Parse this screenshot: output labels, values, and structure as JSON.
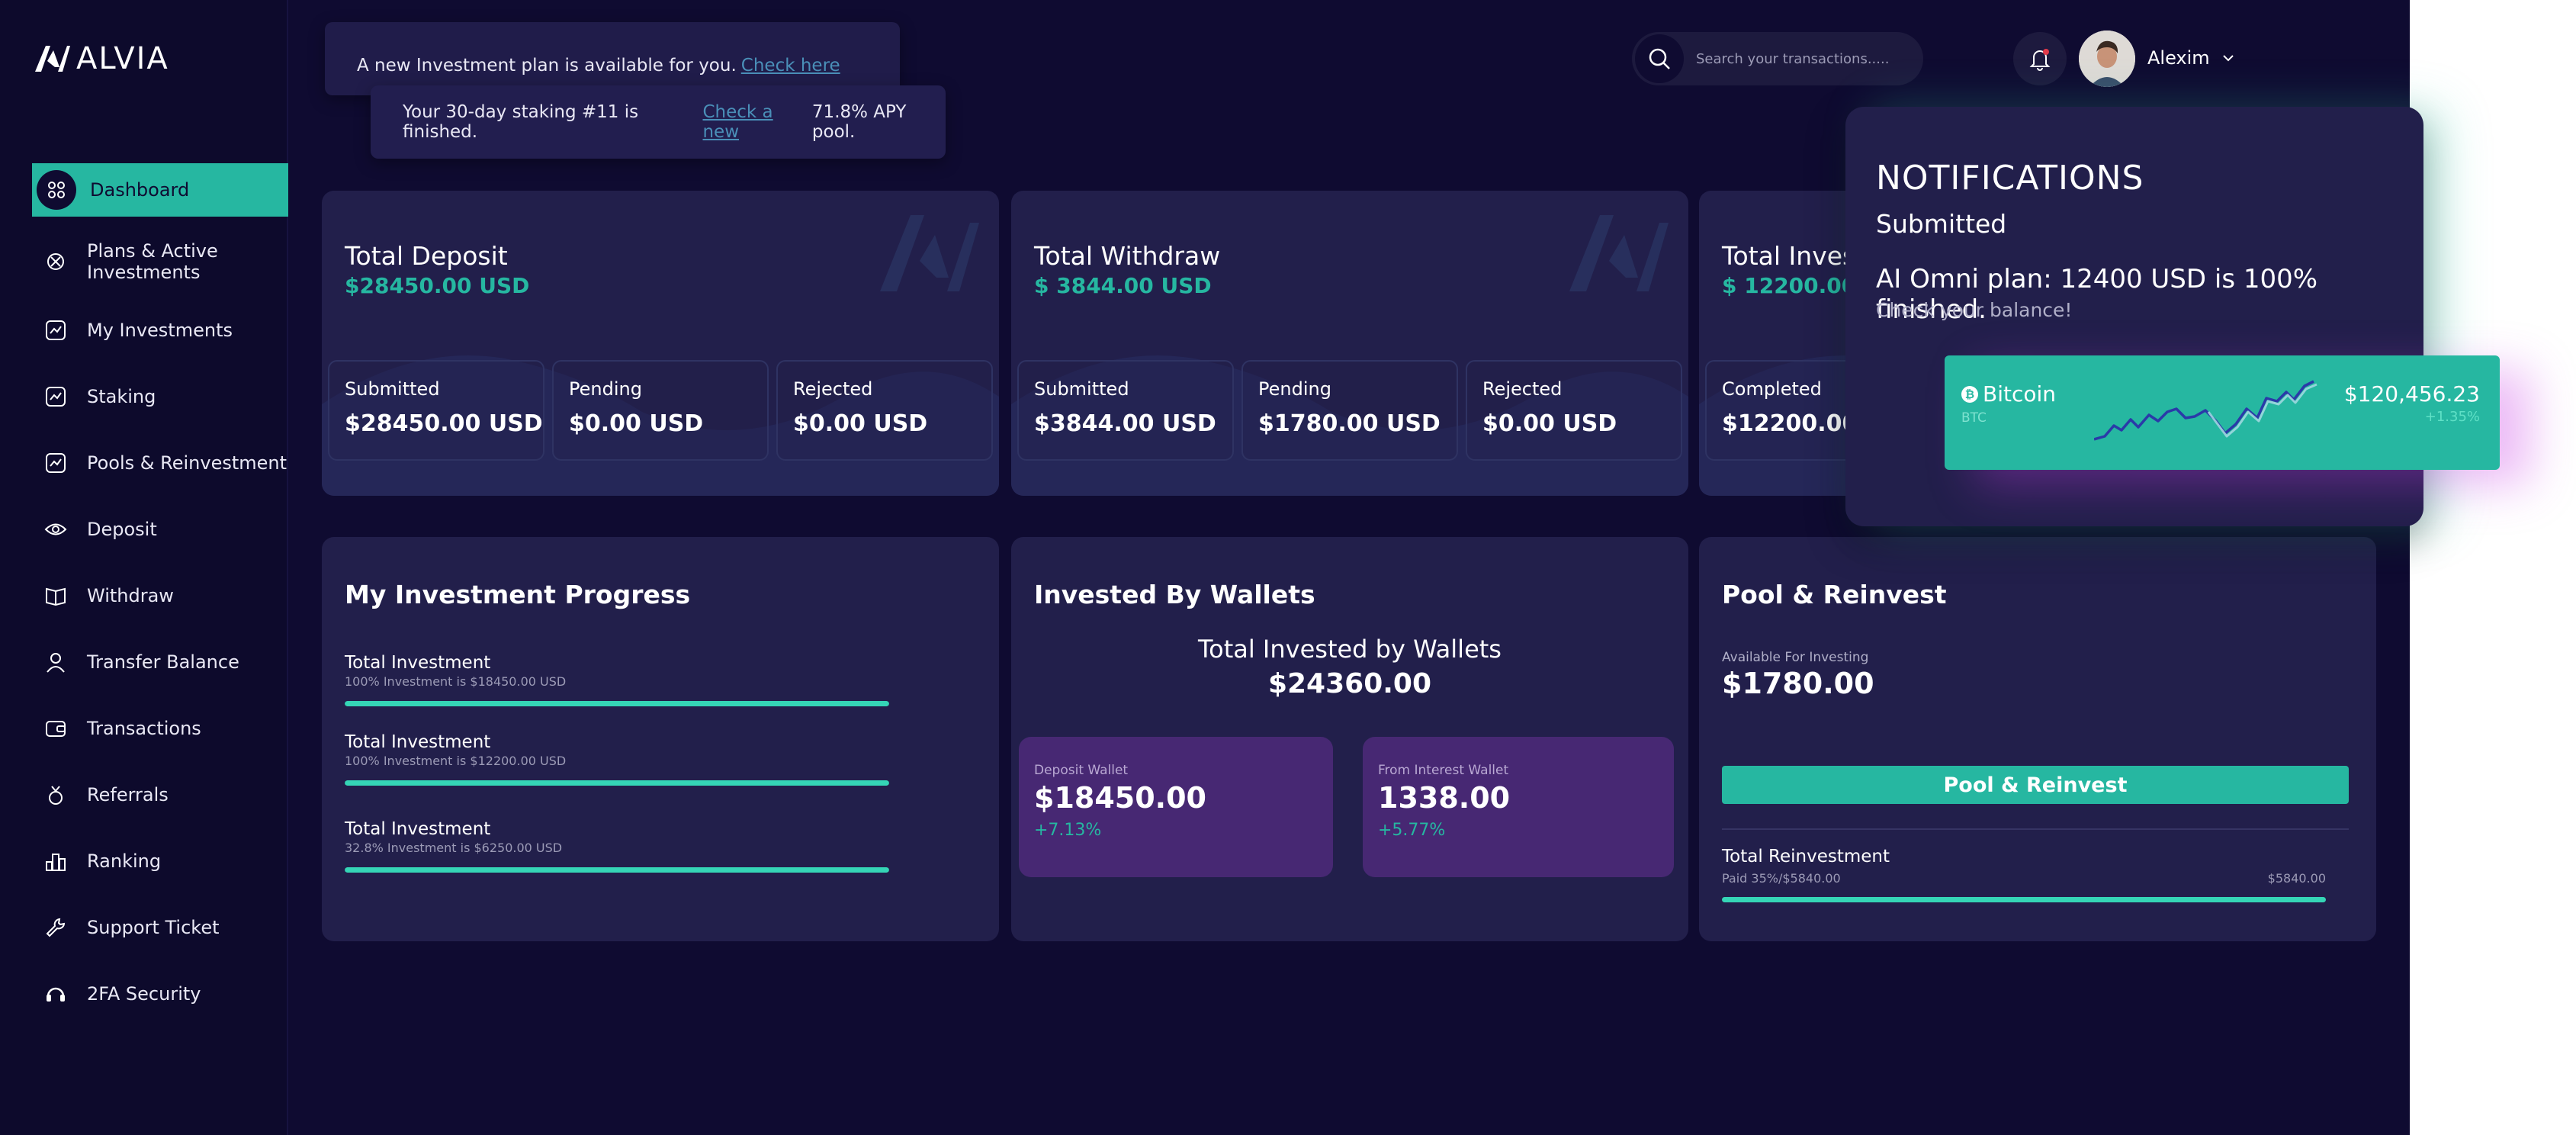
{
  "brand": {
    "name": "ALVIA"
  },
  "sidebar": {
    "items": [
      {
        "label": "Dashboard",
        "icon": "dashboard-icon",
        "active": true
      },
      {
        "label": "Plans & Active Investments",
        "icon": "plans-icon"
      },
      {
        "label": "My Investments",
        "icon": "chart-icon"
      },
      {
        "label": "Staking",
        "icon": "chart-icon"
      },
      {
        "label": "Pools & Reinvestment",
        "icon": "chart-icon"
      },
      {
        "label": "Deposit",
        "icon": "eye-icon"
      },
      {
        "label": "Withdraw",
        "icon": "book-icon"
      },
      {
        "label": "Transfer Balance",
        "icon": "user-icon"
      },
      {
        "label": "Transactions",
        "icon": "wallet-icon"
      },
      {
        "label": "Referrals",
        "icon": "referral-icon"
      },
      {
        "label": "Ranking",
        "icon": "ranking-icon"
      },
      {
        "label": "Support Ticket",
        "icon": "wrench-icon"
      },
      {
        "label": "2FA Security",
        "icon": "headset-icon"
      }
    ]
  },
  "toasts": {
    "first": {
      "text": "A new Investment plan is available for you.",
      "link": "Check here"
    },
    "second": {
      "text": "Your 30-day staking #11 is finished.",
      "link": "Check a new",
      "after": "71.8% APY pool."
    }
  },
  "header": {
    "search_placeholder": "Search your transactions.....",
    "user_name": "Alexim"
  },
  "stats": [
    {
      "title": "Total Deposit",
      "value": "$28450.00 USD",
      "items": [
        {
          "label": "Submitted",
          "value": "$28450.00 USD"
        },
        {
          "label": "Pending",
          "value": "$0.00 USD"
        },
        {
          "label": "Rejected",
          "value": "$0.00 USD"
        }
      ]
    },
    {
      "title": "Total Withdraw",
      "value": "$ 3844.00 USD",
      "items": [
        {
          "label": "Submitted",
          "value": "$3844.00 USD"
        },
        {
          "label": "Pending",
          "value": "$1780.00 USD"
        },
        {
          "label": "Rejected",
          "value": "$0.00 USD"
        }
      ]
    },
    {
      "title": "Total Inves",
      "value": "$ 12200.00",
      "items": [
        {
          "label": "Completed",
          "value": "$12200.00"
        }
      ]
    }
  ],
  "progress": {
    "title": "My Investment Progress",
    "items": [
      {
        "title": "Total Investment",
        "sub": "100% Investment is $18450.00 USD",
        "percent": 100
      },
      {
        "title": "Total Investment",
        "sub": "100% Investment is  $12200.00 USD",
        "percent": 100
      },
      {
        "title": "Total Investment",
        "sub": "32.8% Investment is $6250.00 USD",
        "percent": 100
      }
    ]
  },
  "wallets": {
    "title": "Invested By Wallets",
    "total_label": "Total Invested by Wallets",
    "total_value": "$24360.00",
    "boxes": [
      {
        "label": "Deposit Wallet",
        "value": "$18450.00",
        "change": "+7.13%"
      },
      {
        "label": "From Interest Wallet",
        "value": "1338.00",
        "change": "+5.77%"
      }
    ]
  },
  "pool": {
    "title": "Pool & Reinvest",
    "available_label": "Available For Investing",
    "available_value": "$1780.00",
    "button": "Pool & Reinvest",
    "reinvest_title": "Total Reinvestment",
    "reinvest_paid": "Paid 35%/$5840.00",
    "reinvest_amount": "$5840.00",
    "reinvest_percent": 100
  },
  "notifications": {
    "title": "NOTIFICATIONS",
    "subtitle": "Submitted",
    "message": "AI Omni plan: 12400 USD is 100% finished.",
    "hint": "Check your balance!",
    "coin": {
      "name": "Bitcoin",
      "symbol": "BTC",
      "price": "$120,456.23",
      "change": "+1.35%"
    }
  },
  "colors": {
    "background": "#0f0b31",
    "card": "#221f4b",
    "accent": "#26b7a1",
    "wallet_box": "#472873",
    "link": "#4a8fb8"
  }
}
